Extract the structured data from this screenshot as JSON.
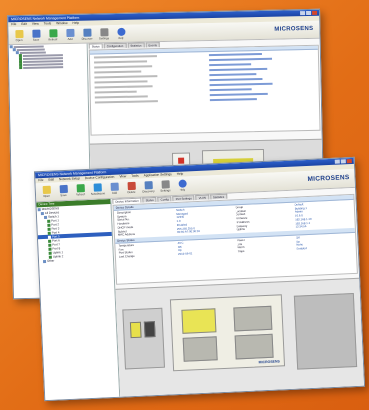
{
  "back": {
    "title": "MICROSENS Network Management Platform",
    "menu": [
      "File",
      "Edit",
      "View",
      "Tools",
      "Window",
      "Help"
    ],
    "toolbar": [
      "Open",
      "Save",
      "Refresh",
      "Add",
      "Discover",
      "Settings",
      "Help"
    ],
    "brand": "MICROSENS",
    "tabs": [
      "Status",
      "Configuration",
      "Statistics",
      "Events"
    ]
  },
  "front": {
    "title": "MICROSENS Network Management Platform",
    "menu": [
      "File",
      "Edit",
      "Network Setup",
      "Device Configuration",
      "View",
      "Tools",
      "Application Settings",
      "Help"
    ],
    "toolbar": [
      "Open",
      "Save",
      "Refresh",
      "Autodiscover",
      "Add",
      "Delete",
      "Discovery",
      "Settings",
      "Help"
    ],
    "brand": "MICROSENS",
    "sidebar_title": "Device Tree",
    "tree": [
      "MICROSENS",
      "All Devices",
      "Switch 1",
      "Port 1",
      "Port 2",
      "Port 3",
      "Port 4",
      "Port 5",
      "Port 6",
      "Port 7",
      "Port 8",
      "Uplink 1",
      "Uplink 2",
      "Other"
    ],
    "tabs": [
      "Device Information",
      "Status",
      "Config",
      "Port Settings",
      "VLAN",
      "Statistics"
    ],
    "section1": "Device Details",
    "section2": "Device Status",
    "details": [
      [
        "Description",
        "Switch",
        "Group",
        "Default"
      ],
      [
        "System",
        "Managed",
        "Location",
        "Building 1"
      ],
      [
        "Serial No.",
        "12345",
        "Contact",
        "Admin"
      ],
      [
        "Hardware",
        "1.0",
        "Firmware",
        "10.6.0"
      ],
      [
        "DHCP mode",
        "Enabled",
        "IP Address",
        "192.168.1.10"
      ],
      [
        "Subnet",
        "255.255.255.0",
        "Gateway",
        "192.168.1.1"
      ],
      [
        "MAC Address",
        "00:60:A7:00:00:01",
        "Uptime",
        "12:34:56"
      ]
    ],
    "status": [
      [
        "Temperature",
        "40 C",
        "Power",
        "OK"
      ],
      [
        "Fan",
        "OK",
        "Link",
        "Up"
      ],
      [
        "Port Status",
        "Up",
        "Alarm",
        "None"
      ],
      [
        "Last Change",
        "2013-06-01",
        "Traps",
        "Enabled"
      ]
    ],
    "device_brand": "MICROSENS"
  }
}
